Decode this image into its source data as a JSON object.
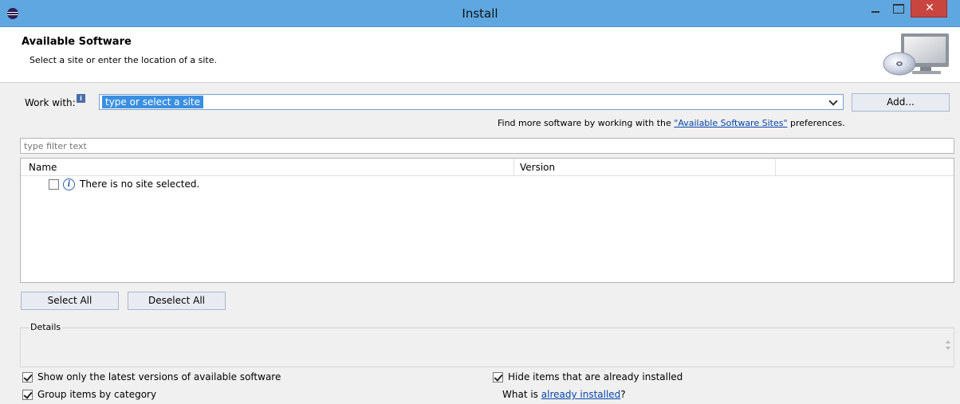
{
  "window": {
    "title": "Install",
    "close_glyph": "✕"
  },
  "header": {
    "title": "Available Software",
    "subtitle": "Select a site or enter the location of a site."
  },
  "work_with": {
    "label": "Work with:",
    "value": "type or select a site",
    "add_label": "Add..."
  },
  "find_more": {
    "prefix": "Find more software by working with the ",
    "link": "\"Available Software Sites\"",
    "suffix": " preferences."
  },
  "filter": {
    "placeholder": "type filter text"
  },
  "tree": {
    "columns": [
      "Name",
      "Version"
    ],
    "rows": [
      {
        "label": "There is no site selected.",
        "checked": false
      }
    ]
  },
  "buttons": {
    "select_all": "Select All",
    "deselect_all": "Deselect All"
  },
  "details": {
    "label": "Details"
  },
  "options": {
    "latest_versions": {
      "label": "Show only the latest versions of available software",
      "checked": true
    },
    "hide_installed": {
      "label": "Hide items that are already installed",
      "checked": true
    },
    "group_by_category": {
      "label": "Group items by category",
      "checked": true
    },
    "what_is_prefix": "What is ",
    "what_is_link": "already installed",
    "what_is_suffix": "?"
  },
  "colors": {
    "titlebar": "#5fa7e0",
    "close": "#c84540",
    "selection": "#3a8fe0",
    "link": "#0645ad"
  }
}
